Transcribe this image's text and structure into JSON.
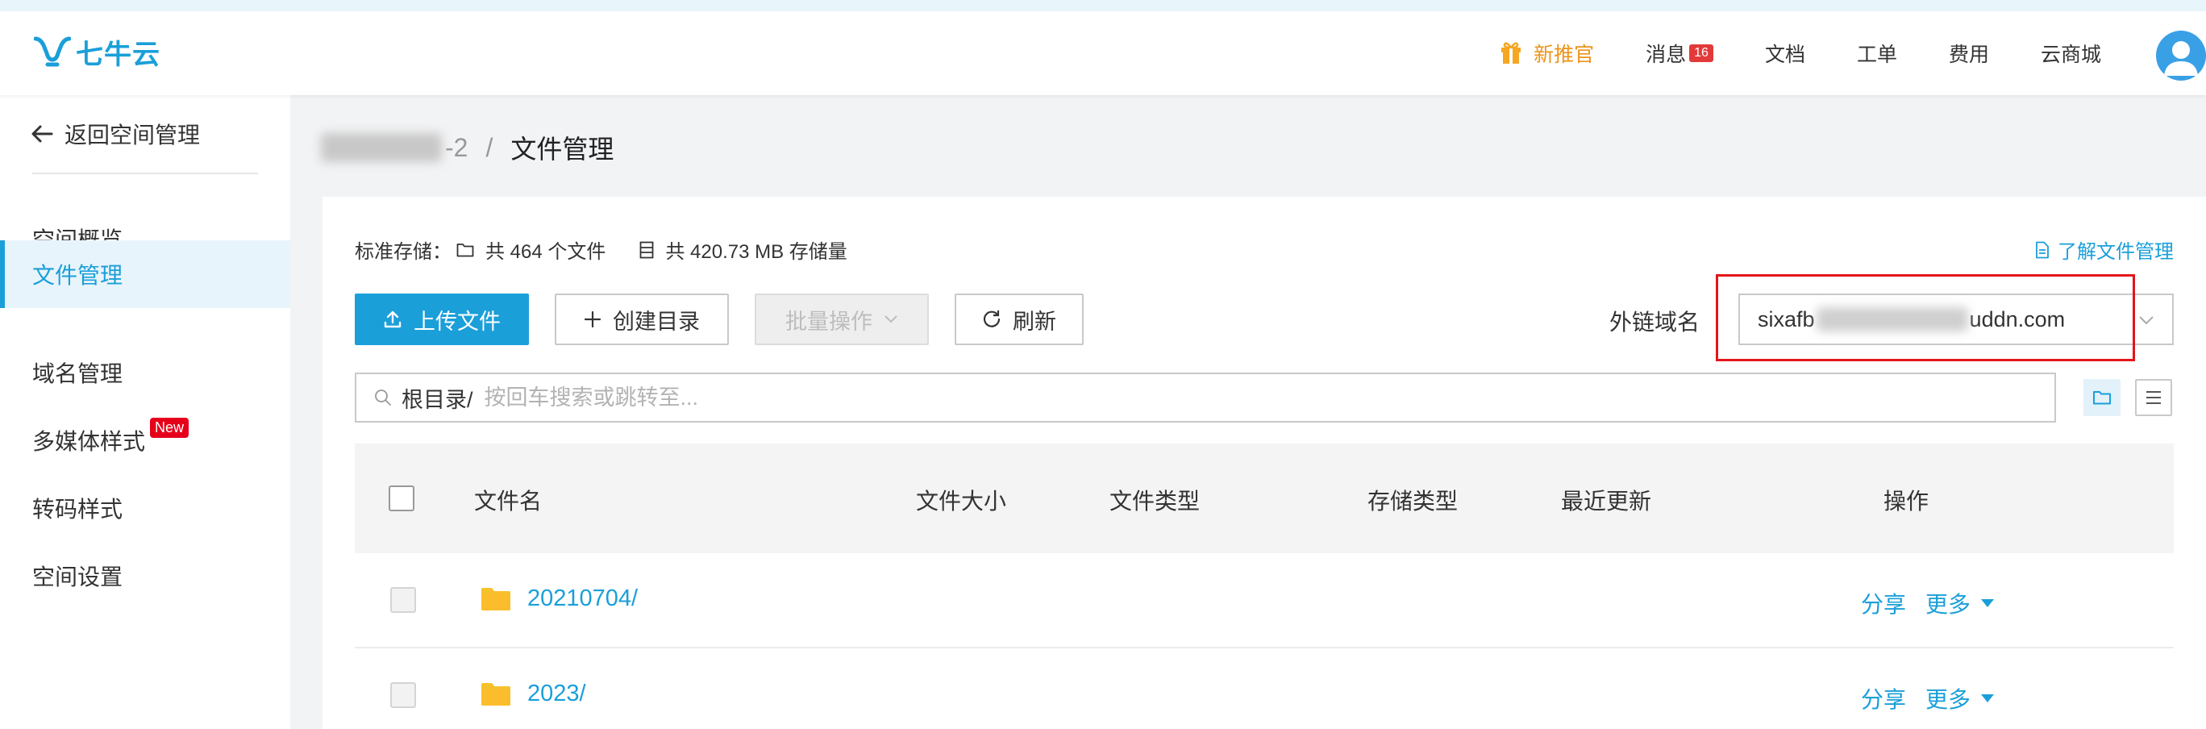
{
  "brand": {
    "logo_text": "七牛云",
    "accent": "#1a9fd9"
  },
  "header": {
    "nav": [
      {
        "label": "新推官",
        "icon": "gift-icon"
      },
      {
        "label": "消息",
        "badge": "16"
      },
      {
        "label": "文档"
      },
      {
        "label": "工单"
      },
      {
        "label": "费用"
      },
      {
        "label": "云商城"
      }
    ]
  },
  "sidebar": {
    "back_label": "返回空间管理",
    "items": [
      {
        "label": "空间概览"
      },
      {
        "label": "文件管理",
        "active": true
      },
      {
        "label": "域名管理"
      },
      {
        "label": "多媒体样式",
        "badge": "New"
      },
      {
        "label": "转码样式"
      },
      {
        "label": "空间设置"
      }
    ]
  },
  "breadcrumb": {
    "bucket_suffix": "-2",
    "separator": "/",
    "current": "文件管理"
  },
  "stats": {
    "storage_label": "标准存储：",
    "files_text": "共 464 个文件",
    "size_text": "共 420.73 MB 存储量"
  },
  "learn_link": "了解文件管理",
  "toolbar": {
    "upload": "上传文件",
    "create_dir": "创建目录",
    "batch": "批量操作",
    "refresh": "刷新"
  },
  "domain": {
    "label": "外链域名",
    "prefix": "sixafb",
    "suffix": "uddn.com"
  },
  "search": {
    "root": "根目录/",
    "placeholder": "按回车搜索或跳转至..."
  },
  "table": {
    "headers": [
      "文件名",
      "文件大小",
      "文件类型",
      "存储类型",
      "最近更新",
      "操作"
    ],
    "rows": [
      {
        "name": "20210704/"
      },
      {
        "name": "2023/"
      }
    ],
    "actions": {
      "share": "分享",
      "more": "更多"
    }
  }
}
